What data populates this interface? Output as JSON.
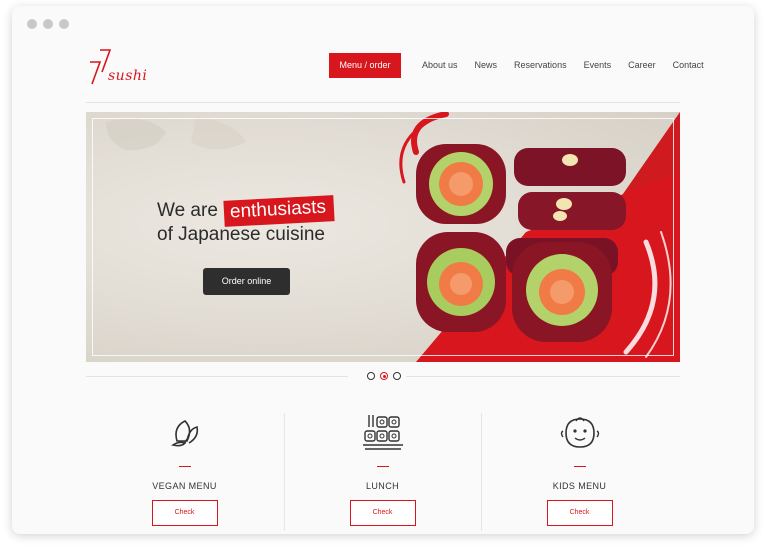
{
  "brand": {
    "logo_text": "sushi",
    "logo_digits": "77"
  },
  "header": {
    "menu_button": "Menu / order",
    "nav": [
      "About us",
      "News",
      "Reservations",
      "Events",
      "Career",
      "Contact"
    ]
  },
  "hero": {
    "line1_pre": "We are",
    "line1_highlight": "enthusiasts",
    "line2": "of Japanese cuisine",
    "cta": "Order online"
  },
  "carousel": {
    "slides": 3,
    "active_index": 1
  },
  "features": [
    {
      "icon": "leaf-icon",
      "title": "VEGAN MENU",
      "button": "Check"
    },
    {
      "icon": "sushi-icon",
      "title": "LUNCH",
      "button": "Check"
    },
    {
      "icon": "baby-face-icon",
      "title": "KIDS MENU",
      "button": "Check"
    }
  ],
  "colors": {
    "accent": "#d8161d",
    "dark_button": "#2e2e2e"
  }
}
